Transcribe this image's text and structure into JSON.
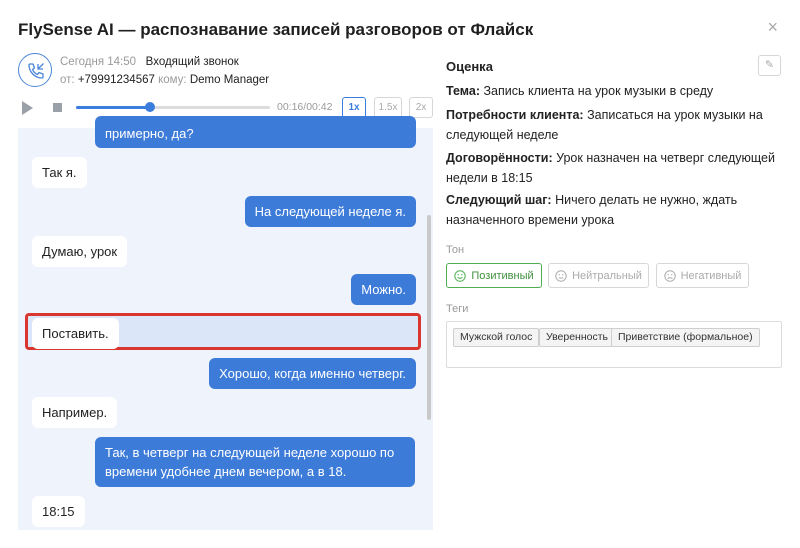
{
  "window": {
    "title": "FlySense AI — распознавание записей разговоров от Флайск",
    "close_label": "×"
  },
  "call": {
    "date": "Сегодня 14:50",
    "type": "Входящий звонок",
    "from_label": "от:",
    "from_number": "+79991234567",
    "to_label": "кому:",
    "to_name": "Demo Manager",
    "icon": "phone-incoming-icon"
  },
  "player": {
    "time": "00:16/00:42",
    "progress": 0.38,
    "speeds": [
      "1x",
      "1.5x",
      "2x"
    ],
    "active_speed": "1x"
  },
  "chat": {
    "messages": [
      {
        "side": "out",
        "text": "примерно, да?"
      },
      {
        "side": "in",
        "text": "Так я."
      },
      {
        "side": "out",
        "text": "На следующей неделе я."
      },
      {
        "side": "in",
        "text": "Думаю, урок"
      },
      {
        "side": "out",
        "text": "Можно."
      },
      {
        "side": "in",
        "text": "Поставить.",
        "highlighted": true
      },
      {
        "side": "out",
        "text": "Хорошо, когда именно четверг."
      },
      {
        "side": "in",
        "text": "Например."
      },
      {
        "side": "out",
        "text": "Так, в четверг на следующей неделе хорошо по времени удобнее днем вечером, а в 18."
      },
      {
        "side": "in",
        "text": "18:15"
      }
    ],
    "highlight_color": "#d9362f"
  },
  "assessment": {
    "title": "Оценка",
    "edit_icon": "pencil-icon",
    "fields": [
      {
        "label": "Тема:",
        "value": "Запись клиента на урок музыки в среду"
      },
      {
        "label": "Потребности клиента:",
        "value": "Записаться на урок музыки на следующей неделе"
      },
      {
        "label": "Договорённости:",
        "value": "Урок назначен на четверг следующей недели в 18:15"
      },
      {
        "label": "Следующий шаг:",
        "value": "Ничего делать не нужно, ждать назначенного времени урока"
      }
    ],
    "tone_label": "Тон",
    "tones": [
      {
        "label": "Позитивный",
        "active": true,
        "icon": "smile-icon"
      },
      {
        "label": "Нейтральный",
        "active": false,
        "icon": "neutral-face-icon"
      },
      {
        "label": "Негативный",
        "active": false,
        "icon": "sad-face-icon"
      }
    ],
    "tags_label": "Теги",
    "tags": [
      "Мужской голос",
      "Уверенность",
      "Приветствие (формальное)"
    ]
  },
  "colors": {
    "accent": "#3b7ddd",
    "bubble_out": "#3d7bd8",
    "chat_bg": "#eef3fc",
    "positive": "#4caf50"
  }
}
